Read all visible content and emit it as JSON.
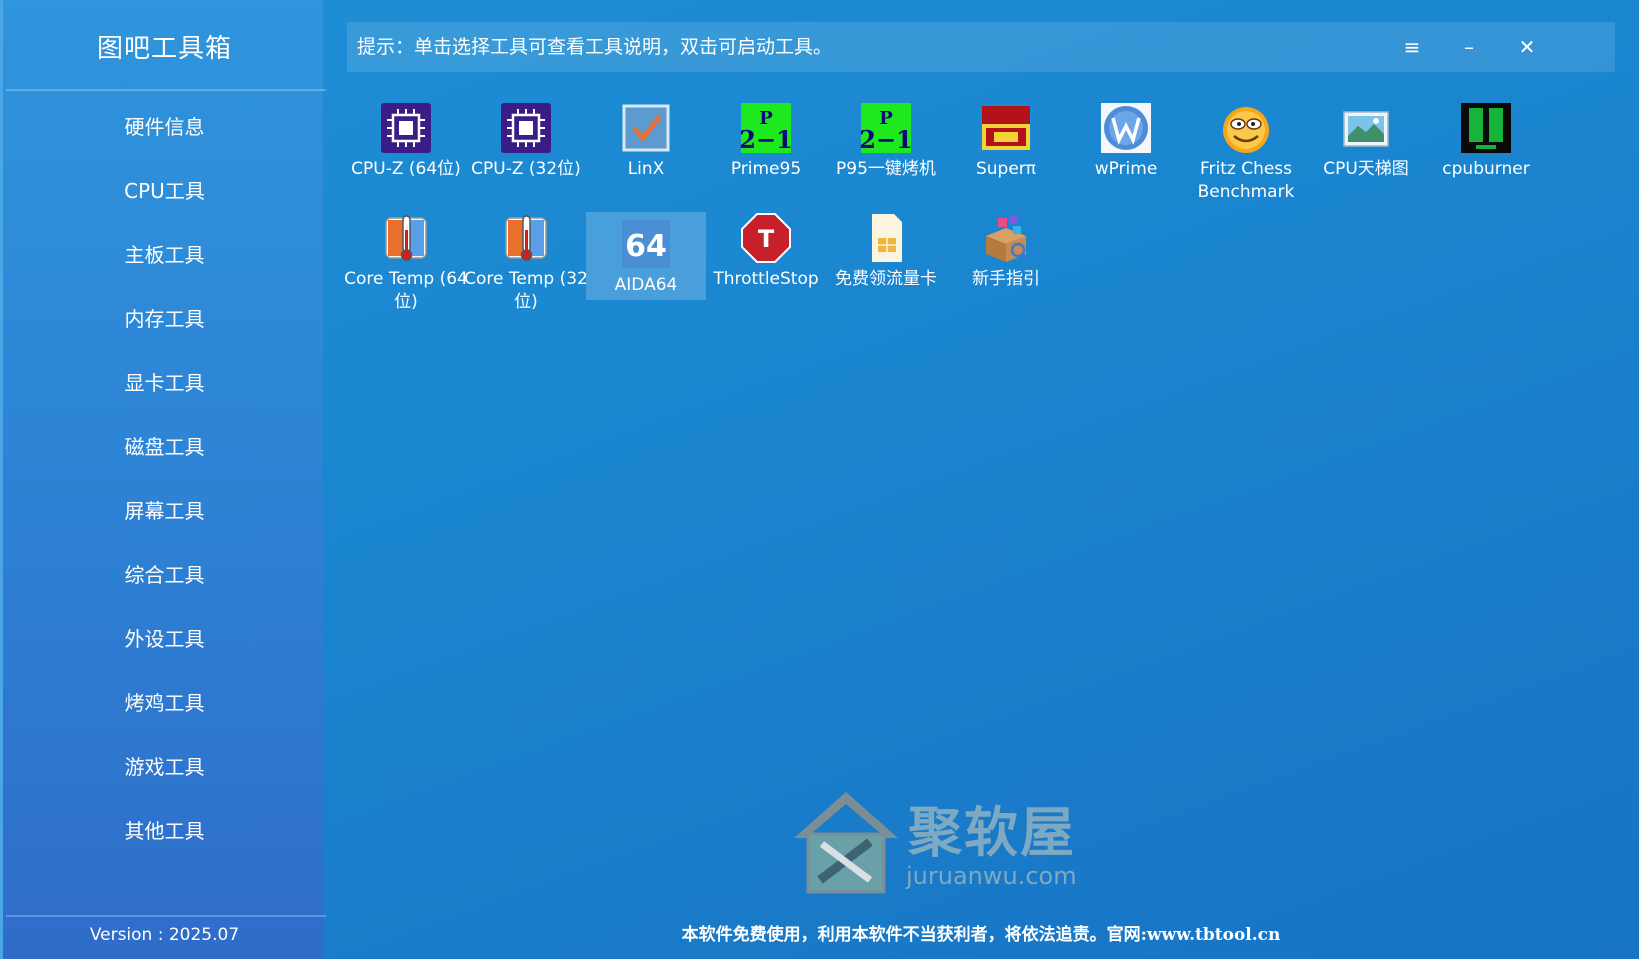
{
  "app": {
    "title": "图吧工具箱",
    "version": "Version : 2025.07"
  },
  "sidebar": {
    "items": [
      {
        "label": "硬件信息"
      },
      {
        "label": "CPU工具"
      },
      {
        "label": "主板工具"
      },
      {
        "label": "内存工具"
      },
      {
        "label": "显卡工具"
      },
      {
        "label": "磁盘工具"
      },
      {
        "label": "屏幕工具"
      },
      {
        "label": "综合工具"
      },
      {
        "label": "外设工具"
      },
      {
        "label": "烤鸡工具"
      },
      {
        "label": "游戏工具"
      },
      {
        "label": "其他工具"
      }
    ]
  },
  "topbar": {
    "hint": "提示：单击选择工具可查看工具说明，双击可启动工具。",
    "menu_glyph": "≡",
    "minimize_glyph": "–",
    "close_glyph": "✕"
  },
  "tools": [
    {
      "label": "CPU-Z (64位)",
      "icon": "cpu-chip-icon"
    },
    {
      "label": "CPU-Z (32位)",
      "icon": "cpu-chip-icon"
    },
    {
      "label": "LinX",
      "icon": "checkbox-icon"
    },
    {
      "label": "Prime95",
      "icon": "prime-icon"
    },
    {
      "label": "P95一键烤机",
      "icon": "prime-icon"
    },
    {
      "label": "Superπ",
      "icon": "superpi-icon"
    },
    {
      "label": "wPrime",
      "icon": "wprime-icon"
    },
    {
      "label": "Fritz Chess Benchmark",
      "icon": "smiley-icon"
    },
    {
      "label": "CPU天梯图",
      "icon": "landscape-icon"
    },
    {
      "label": "cpuburner",
      "icon": "cpuburner-icon"
    },
    {
      "label": "Core Temp (64位)",
      "icon": "thermometer-icon"
    },
    {
      "label": "Core Temp (32位)",
      "icon": "thermometer-icon"
    },
    {
      "label": "AIDA64",
      "icon": "aida64-icon",
      "selected": true,
      "icon_text": "64"
    },
    {
      "label": "ThrottleStop",
      "icon": "stop-sign-icon",
      "icon_text": "T"
    },
    {
      "label": "免费领流量卡",
      "icon": "sim-card-icon"
    },
    {
      "label": "新手指引",
      "icon": "package-icon"
    }
  ],
  "watermark": {
    "name": "聚软屋",
    "url": "juruanwu.com"
  },
  "footer": {
    "note": "本软件免费使用，利用本软件不当获利者，将依法追责。官网:www.tbtool.cn"
  },
  "colors": {
    "accent": "#1a86d0",
    "sidebar": "#2d7fd3",
    "selected": "#5aaee6"
  }
}
